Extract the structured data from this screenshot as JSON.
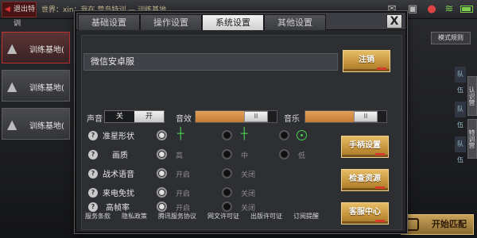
{
  "background": {
    "back_label": "退出特训",
    "ticker": "世界：xin：我在 营岛特训 — 训练基地",
    "cards": [
      "训练基地(",
      "训练基地(",
      "训练基地("
    ],
    "mode_rule_label": "模式规则",
    "side_labels": [
      "队伍",
      "队伍",
      "队伍"
    ],
    "side_tabs": [
      "认识营",
      "特训营"
    ],
    "start_label": "开始匹配"
  },
  "tabs": [
    "基础设置",
    "操作设置",
    "系统设置",
    "其他设置"
  ],
  "active_tab_index": 2,
  "close_label": "X",
  "server_name": "微信安卓服",
  "logout_label": "注销",
  "sound": {
    "label": "声音",
    "off_label": "关",
    "on_label": "开",
    "state": "开"
  },
  "effects": {
    "label": "音效",
    "level": 0.85,
    "knob": "II"
  },
  "music": {
    "label": "音乐",
    "level": 0.85,
    "knob": "II"
  },
  "help_icon": "?",
  "rows": [
    {
      "label": "准星形状",
      "options": [
        "",
        "",
        ""
      ],
      "selected": 0
    },
    {
      "label": "画质",
      "options": [
        "高",
        "中",
        "低"
      ],
      "selected": 0
    },
    {
      "label": "战术语音",
      "options": [
        "开启",
        "关闭"
      ],
      "selected": 0
    },
    {
      "label": "来电免扰",
      "options": [
        "开启",
        "关闭"
      ],
      "selected": 0
    },
    {
      "label": "高帧率",
      "options": [
        "开启",
        "关闭"
      ],
      "selected": 0
    }
  ],
  "right_buttons": [
    "手柄设置",
    "检查资源",
    "客服中心"
  ],
  "footer_links": [
    "服务条款",
    "隐私政策",
    "腾讯服务协议",
    "网文许可证",
    "出版许可证",
    "订阅提醒"
  ],
  "accent_color": "#c8913a",
  "crosshair_color": "#4bd24b"
}
